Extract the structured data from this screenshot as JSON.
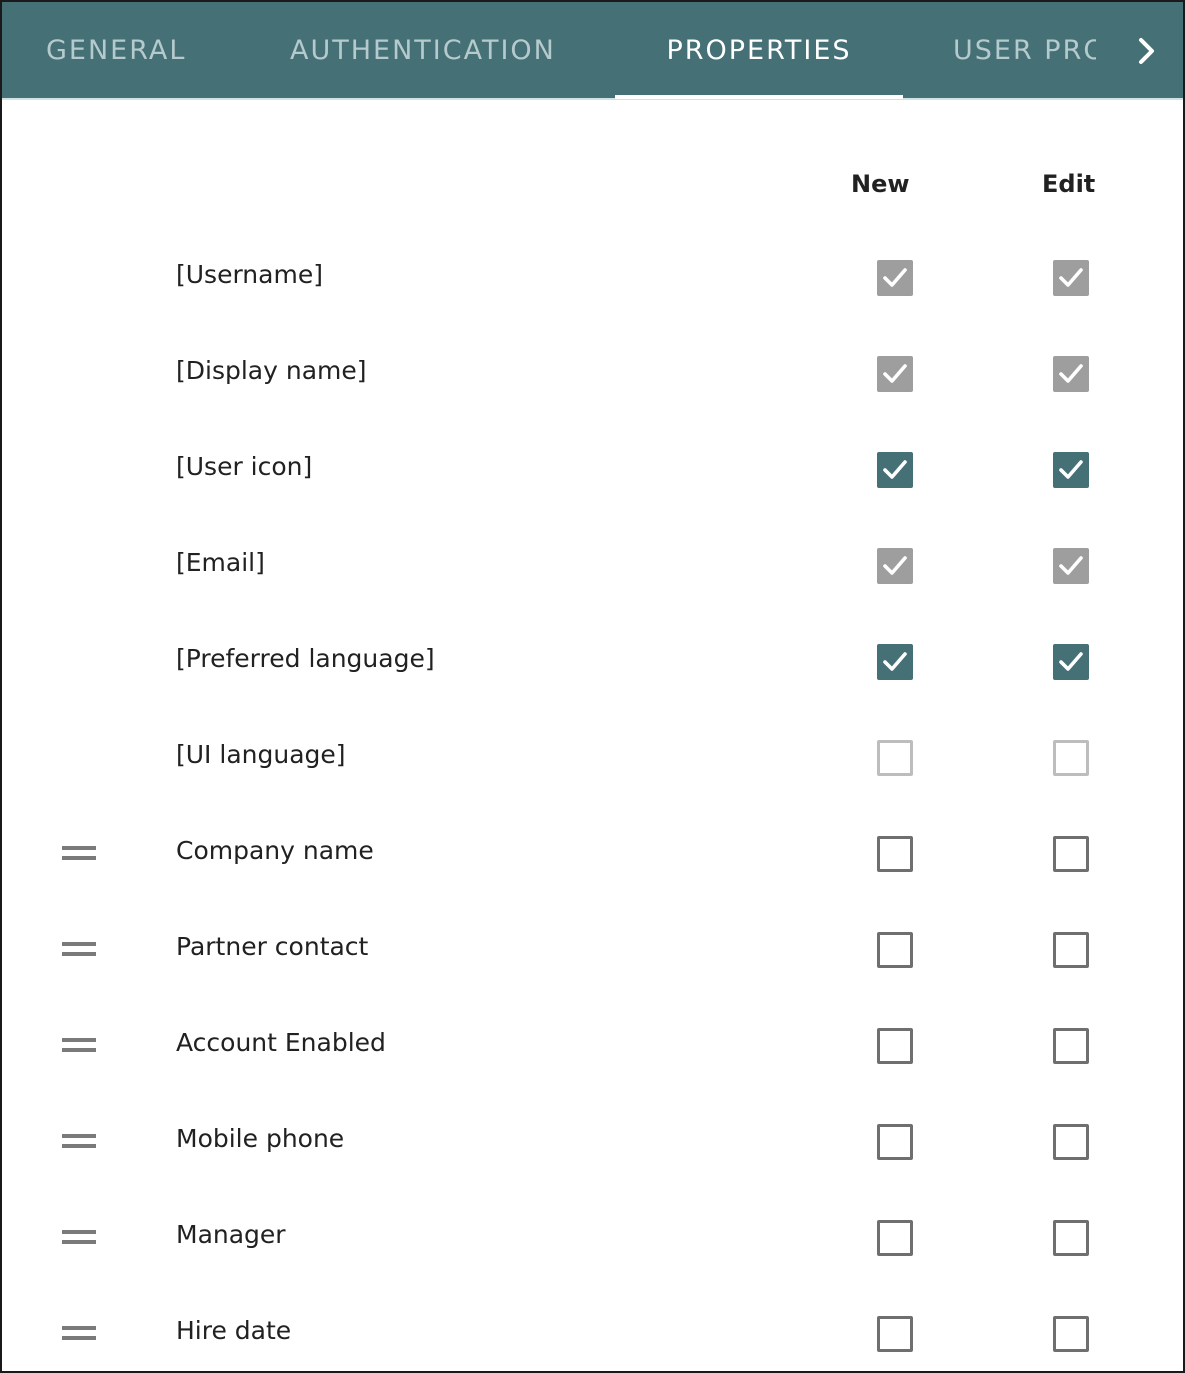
{
  "tabs": {
    "general": "GENERAL",
    "authentication": "AUTHENTICATION",
    "properties": "PROPERTIES",
    "user_profile": "USER PROFILE"
  },
  "columns": {
    "new": "New",
    "edit": "Edit"
  },
  "colors": {
    "tabbar": "#457076",
    "checked": "#457076",
    "disabled": "#9e9e9e"
  },
  "properties": [
    {
      "label": "[Username]",
      "new": "checked-disabled",
      "edit": "checked-disabled",
      "draggable": false
    },
    {
      "label": "[Display name]",
      "new": "checked-disabled",
      "edit": "checked-disabled",
      "draggable": false
    },
    {
      "label": "[User icon]",
      "new": "checked",
      "edit": "checked",
      "draggable": false
    },
    {
      "label": "[Email]",
      "new": "checked-disabled",
      "edit": "checked-disabled",
      "draggable": false
    },
    {
      "label": "[Preferred language]",
      "new": "checked",
      "edit": "checked",
      "draggable": false
    },
    {
      "label": "[UI language]",
      "new": "unchecked-disabled",
      "edit": "unchecked-disabled",
      "draggable": false
    },
    {
      "label": "Company name",
      "new": "unchecked",
      "edit": "unchecked",
      "draggable": true
    },
    {
      "label": "Partner contact",
      "new": "unchecked",
      "edit": "unchecked",
      "draggable": true
    },
    {
      "label": "Account Enabled",
      "new": "unchecked",
      "edit": "unchecked",
      "draggable": true
    },
    {
      "label": "Mobile phone",
      "new": "unchecked",
      "edit": "unchecked",
      "draggable": true
    },
    {
      "label": "Manager",
      "new": "unchecked",
      "edit": "unchecked",
      "draggable": true
    },
    {
      "label": "Hire date",
      "new": "unchecked",
      "edit": "unchecked",
      "draggable": true
    }
  ]
}
